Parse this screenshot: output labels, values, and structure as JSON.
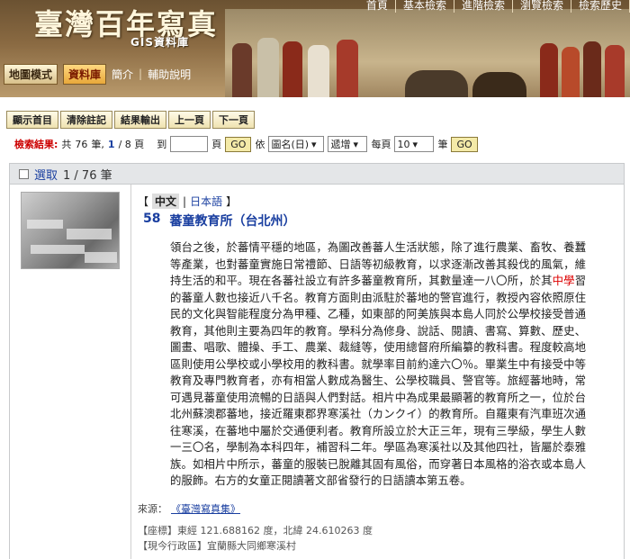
{
  "header": {
    "title": "臺灣百年寫真",
    "subtitle": "GIS資料庫",
    "top_nav": [
      "首頁",
      "基本檢索",
      "進階檢索",
      "瀏覽檢索",
      "檢索歷史"
    ]
  },
  "mode_bar": {
    "map_mode": "地圖模式",
    "database": "資料庫",
    "intro": "簡介",
    "help": "輔助說明"
  },
  "toolbar": [
    "顯示首目",
    "清除註記",
    "結果輸出",
    "上一頁",
    "下一頁"
  ],
  "results": {
    "label": "檢索結果:",
    "total_prefix": "共",
    "total": "76",
    "total_unit": "筆,",
    "page_current": "1",
    "page_total": "/ 8 頁",
    "goto_label": "到",
    "goto_unit": "頁",
    "go_label": "GO",
    "sort_by_label": "依",
    "sort_field": "圖名(日)",
    "sort_order": "遞增",
    "per_page_label": "每頁",
    "per_page": "10",
    "per_page_unit": "筆",
    "go2_label": "GO"
  },
  "record_head": {
    "select_label": "選取",
    "count": "1 / 76 筆"
  },
  "record": {
    "lang_zh": "中文",
    "lang_ja": "日本語",
    "number": "58",
    "title": "蕃童教育所（台北州）",
    "text_before": "領台之後，於蕃情平穩的地區，為圖改善蕃人生活狀態，除了進行農業、畜牧、養蠶等產業，也對蕃童實施日常禮節、日語等初級教育，以求逐漸改善其殺伐的風氣，維持生活的和平。現在各蕃社設立有許多蕃童教育所，其數量達一八〇所，於其",
    "text_highlight": "中學",
    "text_after": "習的蕃童人數也接近八千名。教育方面則由派駐於蕃地的警官進行，教授內容依照原住民的文化與智能程度分為甲種、乙種，如東部的阿美族與本島人同於公學校接受普通教育，其他則主要為四年的教育。學科分為修身、說話、閱讀、書寫、算數、歷史、圖畫、唱歌、體操、手工、農業、裁縫等，使用總督府所編纂的教科書。程度較高地區則使用公學校或小學校用的教科書。就學率目前約達六〇％。畢業生中有接受中等教育及專門教育者，亦有相當人數成為醫生、公學校職員、警官等。旅經蕃地時，常可遇見蕃童使用流暢的日語與人們對話。相片中為成果最顯著的教育所之一，位於台北州蘇澳郡蕃地，接近羅東郡界寒溪社（カンクイ）的教育所。自羅東有汽車班次通往寒溪，在蕃地中屬於交通便利者。教育所設立於大正三年，現有三學級，學生人數一三〇名，學制為本科四年，補習科二年。學區為寒溪社以及其他四社，皆屬於泰雅族。如相片中所示，蕃童的服裝已脫離其固有風俗，而穿著日本風格的浴衣或本島人的服飾。右方的女童正閱讀著文部省發行的日語讀本第五卷。",
    "source_label": "來源：",
    "source_link": "《臺灣寫真集》",
    "coords": "【座標】東經 121.688162 度，北緯 24.610263 度",
    "district": "【現今行政區】宜蘭縣大同鄉寒溪村"
  },
  "colors": {
    "accent_blue": "#1a3fa0",
    "highlight_red": "#dd0000",
    "header_brown": "#6b5232"
  }
}
